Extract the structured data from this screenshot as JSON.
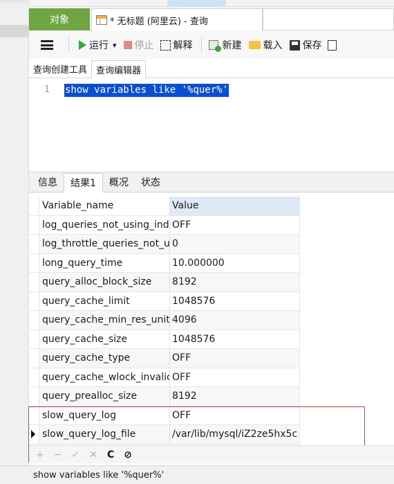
{
  "tabs": {
    "objects": "对象",
    "query_tab_title": "* 无标题 (阿里云) - 查询"
  },
  "toolbar": {
    "run": "运行",
    "run_dropdown": "▾",
    "stop": "停止",
    "explain": "解释",
    "new": "新建",
    "load": "载入",
    "save": "保存"
  },
  "subtabs": {
    "builder": "查询创建工具",
    "editor": "查询编辑器"
  },
  "editor": {
    "line_number": "1",
    "code": "show variables like '%quer%'"
  },
  "result_tabs": [
    "信息",
    "结果1",
    "概况",
    "状态"
  ],
  "grid": {
    "columns": [
      "Variable_name",
      "Value"
    ],
    "rows": [
      {
        "name": "log_queries_not_using_ind",
        "value": "OFF"
      },
      {
        "name": "log_throttle_queries_not_u",
        "value": "0"
      },
      {
        "name": "long_query_time",
        "value": "10.000000"
      },
      {
        "name": "query_alloc_block_size",
        "value": "8192"
      },
      {
        "name": "query_cache_limit",
        "value": "1048576"
      },
      {
        "name": "query_cache_min_res_unit",
        "value": "4096"
      },
      {
        "name": "query_cache_size",
        "value": "1048576"
      },
      {
        "name": "query_cache_type",
        "value": "OFF"
      },
      {
        "name": "query_cache_wlock_invalic",
        "value": "OFF"
      },
      {
        "name": "query_prealloc_size",
        "value": "8192"
      },
      {
        "name": "slow_query_log",
        "value": "OFF"
      },
      {
        "name": "slow_query_log_file",
        "value": "/var/lib/mysql/iZ2ze5hx5c"
      }
    ]
  },
  "grid_footer": {
    "add": "+",
    "remove": "−",
    "apply": "✓",
    "discard": "✕",
    "refresh": "C",
    "stop": "⊘"
  },
  "status_bar": {
    "text": "show variables like '%quer%'"
  },
  "colors": {
    "objects_tab": "#70a544",
    "selection": "#0a4fd1",
    "highlight_box": "#d63b3b",
    "value_header": "#dfe9f5"
  }
}
